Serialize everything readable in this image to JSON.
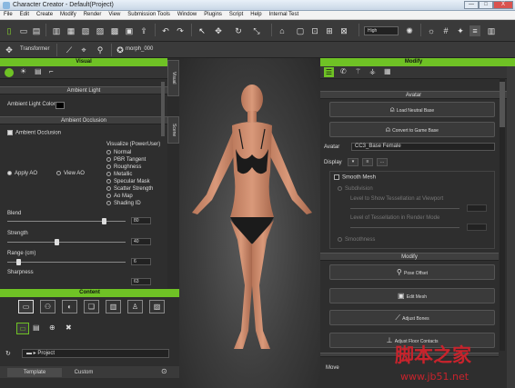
{
  "window": {
    "title": "Character Creator - Default(Project)",
    "min": "—",
    "max": "□",
    "close": "X"
  },
  "menu": [
    "File",
    "Edit",
    "Create",
    "Modify",
    "Render",
    "View",
    "Submission Tools",
    "Window",
    "Plugins",
    "Script",
    "Help",
    "Internal Test"
  ],
  "toolbar": {
    "quality": "High",
    "transformer": "Transformer",
    "morph": "morph_000"
  },
  "visual_panel": {
    "title": "Visual",
    "ambient_light_header": "Ambient Light",
    "ambient_light_color_label": "Ambient Light Color",
    "ambient_occlusion_header": "Ambient Occlusion",
    "ambient_occlusion_checkbox": "Ambient Occlusion",
    "apply_ao": "Apply AO",
    "view_ao": "View AO",
    "visualize_label": "Visualize (PowerUser)",
    "visualize_options": [
      "Normal",
      "PBR Tangent",
      "Roughness",
      "Metallic",
      "Specular Mask",
      "Scatter Strength",
      "Ao Map",
      "Shading ID"
    ],
    "blend_label": "Blend",
    "blend_value": "80",
    "strength_label": "Strength",
    "strength_value": "40",
    "range_label": "Range (cm)",
    "range_value": "6",
    "sharpness_label": "Sharpness",
    "sharpness_value": "63",
    "side_tabs": [
      "Visual",
      "Scene"
    ]
  },
  "content_panel": {
    "title": "Content",
    "path_label": "Project",
    "tab_template": "Template",
    "tab_custom": "Custom"
  },
  "modify_panel": {
    "title": "Modify",
    "avatar_header": "Avatar",
    "load_neutral_base": "Load Neutral Base",
    "convert_to_game_base": "Convert to Game Base",
    "avatar_label": "Avatar",
    "avatar_value": "CC3_Base Female",
    "display_label": "Display",
    "smooth_mesh": "Smooth Mesh",
    "subdivision": "Subdivision",
    "level_view": "Level to Show Tessellation at Viewport",
    "level_render": "Level of Tessellation in Render Mode",
    "smoothness": "Smoothness",
    "modify_header": "Modify",
    "pose_offset": "Pose Offset",
    "edit_mesh": "Edit Mesh",
    "adjust_bones": "Adjust Bones",
    "adjust_floor": "Adjust Floor Contacts",
    "move_label": "Move"
  },
  "watermark": {
    "cn": "脚本之家",
    "url": "www.jb51.net"
  },
  "colors": {
    "accent": "#6fc225",
    "panel": "#2e2e2e",
    "viewport": "#3c3c3c"
  }
}
